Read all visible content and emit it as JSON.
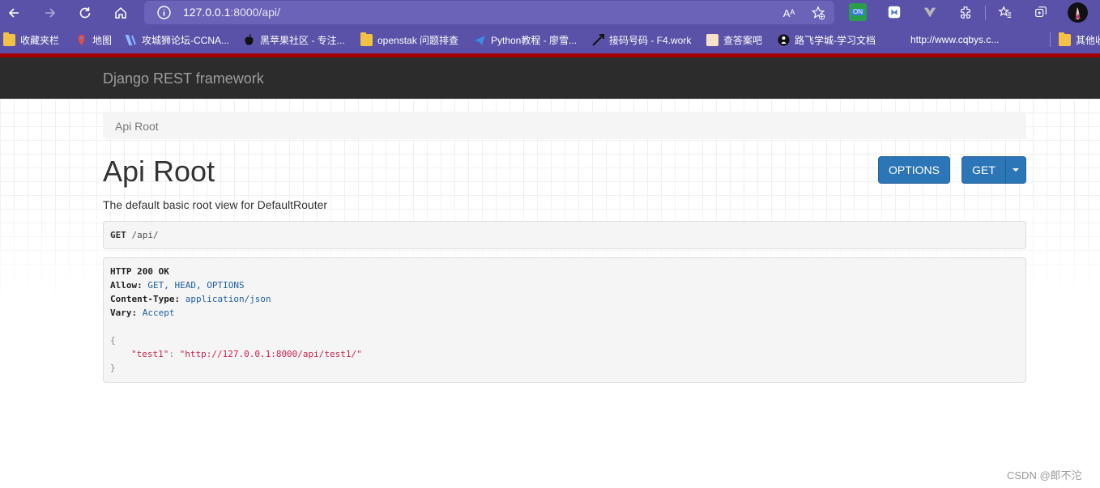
{
  "browser": {
    "url_host": "127.0.0.1",
    "url_rest": ":8000/api/",
    "read_aloud_label": "Aᴬ",
    "ext_badge": "ON"
  },
  "bookmarks": [
    {
      "label": "收藏夹栏"
    },
    {
      "label": "地图"
    },
    {
      "label": "攻城狮论坛-CCNA..."
    },
    {
      "label": "黑苹果社区 - 专注..."
    },
    {
      "label": "openstak 问题排查"
    },
    {
      "label": "Python教程 - 廖雪..."
    },
    {
      "label": "接码号码 - F4.work"
    },
    {
      "label": "查答案吧"
    },
    {
      "label": "路飞学城-学习文档"
    },
    {
      "label": "http://www.cqbys.c..."
    },
    {
      "label": "其他收"
    }
  ],
  "navbar": {
    "brand": "Django REST framework"
  },
  "breadcrumb": {
    "item": "Api Root"
  },
  "main": {
    "title": "Api Root",
    "options_label": "OPTIONS",
    "get_label": "GET",
    "description": "The default basic root view for DefaultRouter"
  },
  "request": {
    "method": "GET",
    "path": "/api/"
  },
  "response": {
    "status": "HTTP 200 OK",
    "allow_key": "Allow:",
    "allow_value": "GET, HEAD, OPTIONS",
    "content_type_key": "Content-Type:",
    "content_type_value": "application/json",
    "vary_key": "Vary:",
    "vary_value": "Accept",
    "open_brace": "{",
    "json_key": "\"test1\"",
    "json_colon": ": ",
    "json_value": "\"http://127.0.0.1:8000/api/test1/\"",
    "close_brace": "}"
  },
  "watermark": "CSDN @郎不沱",
  "colors": {
    "browser_bar": "#5a52a8",
    "navbar": "#2c2c2c",
    "button": "#2c76b7",
    "json_string": "#c7254e"
  }
}
